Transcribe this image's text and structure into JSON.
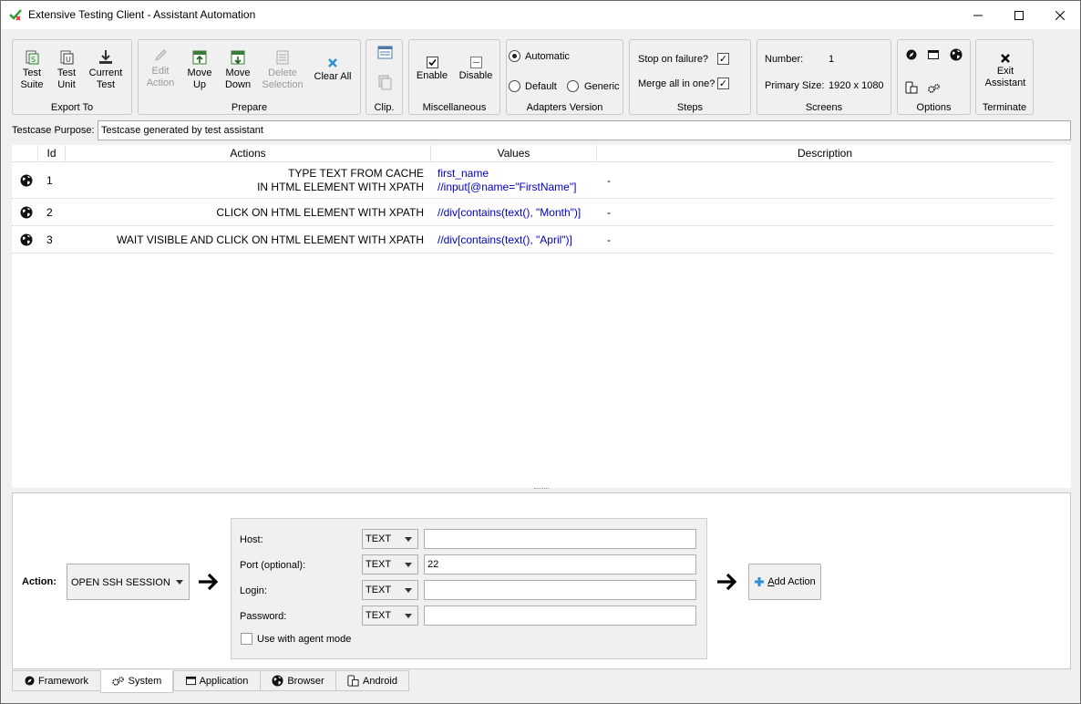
{
  "window": {
    "title": "Extensive Testing Client - Assistant Automation"
  },
  "toolbar": {
    "export": {
      "label": "Export To",
      "buttons": [
        "Test\nSuite",
        "Test\nUnit",
        "Current\nTest"
      ]
    },
    "prepare": {
      "label": "Prepare",
      "buttons": [
        "Edit\nAction",
        "Move\nUp",
        "Move\nDown",
        "Delete\nSelection",
        "Clear All"
      ]
    },
    "clip": {
      "label": "Clip."
    },
    "misc": {
      "label": "Miscellaneous",
      "enable": "Enable",
      "disable": "Disable"
    },
    "adapters": {
      "label": "Adapters Version",
      "automatic": "Automatic",
      "default": "Default",
      "generic": "Generic",
      "selected": "Automatic"
    },
    "steps": {
      "label": "Steps",
      "stop_on_failure": "Stop on failure?",
      "merge_all": "Merge all in one?",
      "stop_checked": true,
      "merge_checked": true
    },
    "screens": {
      "label": "Screens",
      "number_label": "Number:",
      "number_value": "1",
      "primary_label": "Primary Size:",
      "primary_value": "1920 x 1080"
    },
    "options": {
      "label": "Options"
    },
    "terminate": {
      "label": "Terminate",
      "exit": "Exit\nAssistant"
    }
  },
  "purpose": {
    "label": "Testcase Purpose:",
    "value": "Testcase generated by test assistant"
  },
  "table": {
    "columns": [
      "Id",
      "Actions",
      "Values",
      "Description"
    ],
    "rows": [
      {
        "id": "1",
        "action": "TYPE TEXT FROM CACHE\nIN HTML ELEMENT WITH XPATH",
        "values": "first_name\n//input[@name=\"FirstName\"]",
        "description": "-"
      },
      {
        "id": "2",
        "action": "CLICK ON HTML ELEMENT WITH XPATH",
        "values": "//div[contains(text(), \"Month\")]",
        "description": "-"
      },
      {
        "id": "3",
        "action": "WAIT VISIBLE AND CLICK ON HTML ELEMENT WITH XPATH",
        "values": "//div[contains(text(), \"April\")]",
        "description": "-"
      }
    ]
  },
  "action_panel": {
    "action_label": "Action:",
    "action_value": "OPEN SSH SESSION",
    "params": [
      {
        "label": "Host:",
        "type": "TEXT",
        "value": ""
      },
      {
        "label": "Port (optional):",
        "type": "TEXT",
        "value": "22"
      },
      {
        "label": "Login:",
        "type": "TEXT",
        "value": ""
      },
      {
        "label": "Password:",
        "type": "TEXT",
        "value": ""
      }
    ],
    "agent_mode_label": "Use with agent mode",
    "add_action_prefix": "A",
    "add_action_rest": "dd Action"
  },
  "tabs": [
    {
      "label": "Framework",
      "icon": "compass-icon"
    },
    {
      "label": "System",
      "icon": "gears-icon",
      "active": true
    },
    {
      "label": "Application",
      "icon": "window-icon"
    },
    {
      "label": "Browser",
      "icon": "globe-icon"
    },
    {
      "label": "Android",
      "icon": "phone-icon"
    }
  ],
  "colors": {
    "value_text": "#0000c0",
    "background": "#f0f0f0"
  }
}
